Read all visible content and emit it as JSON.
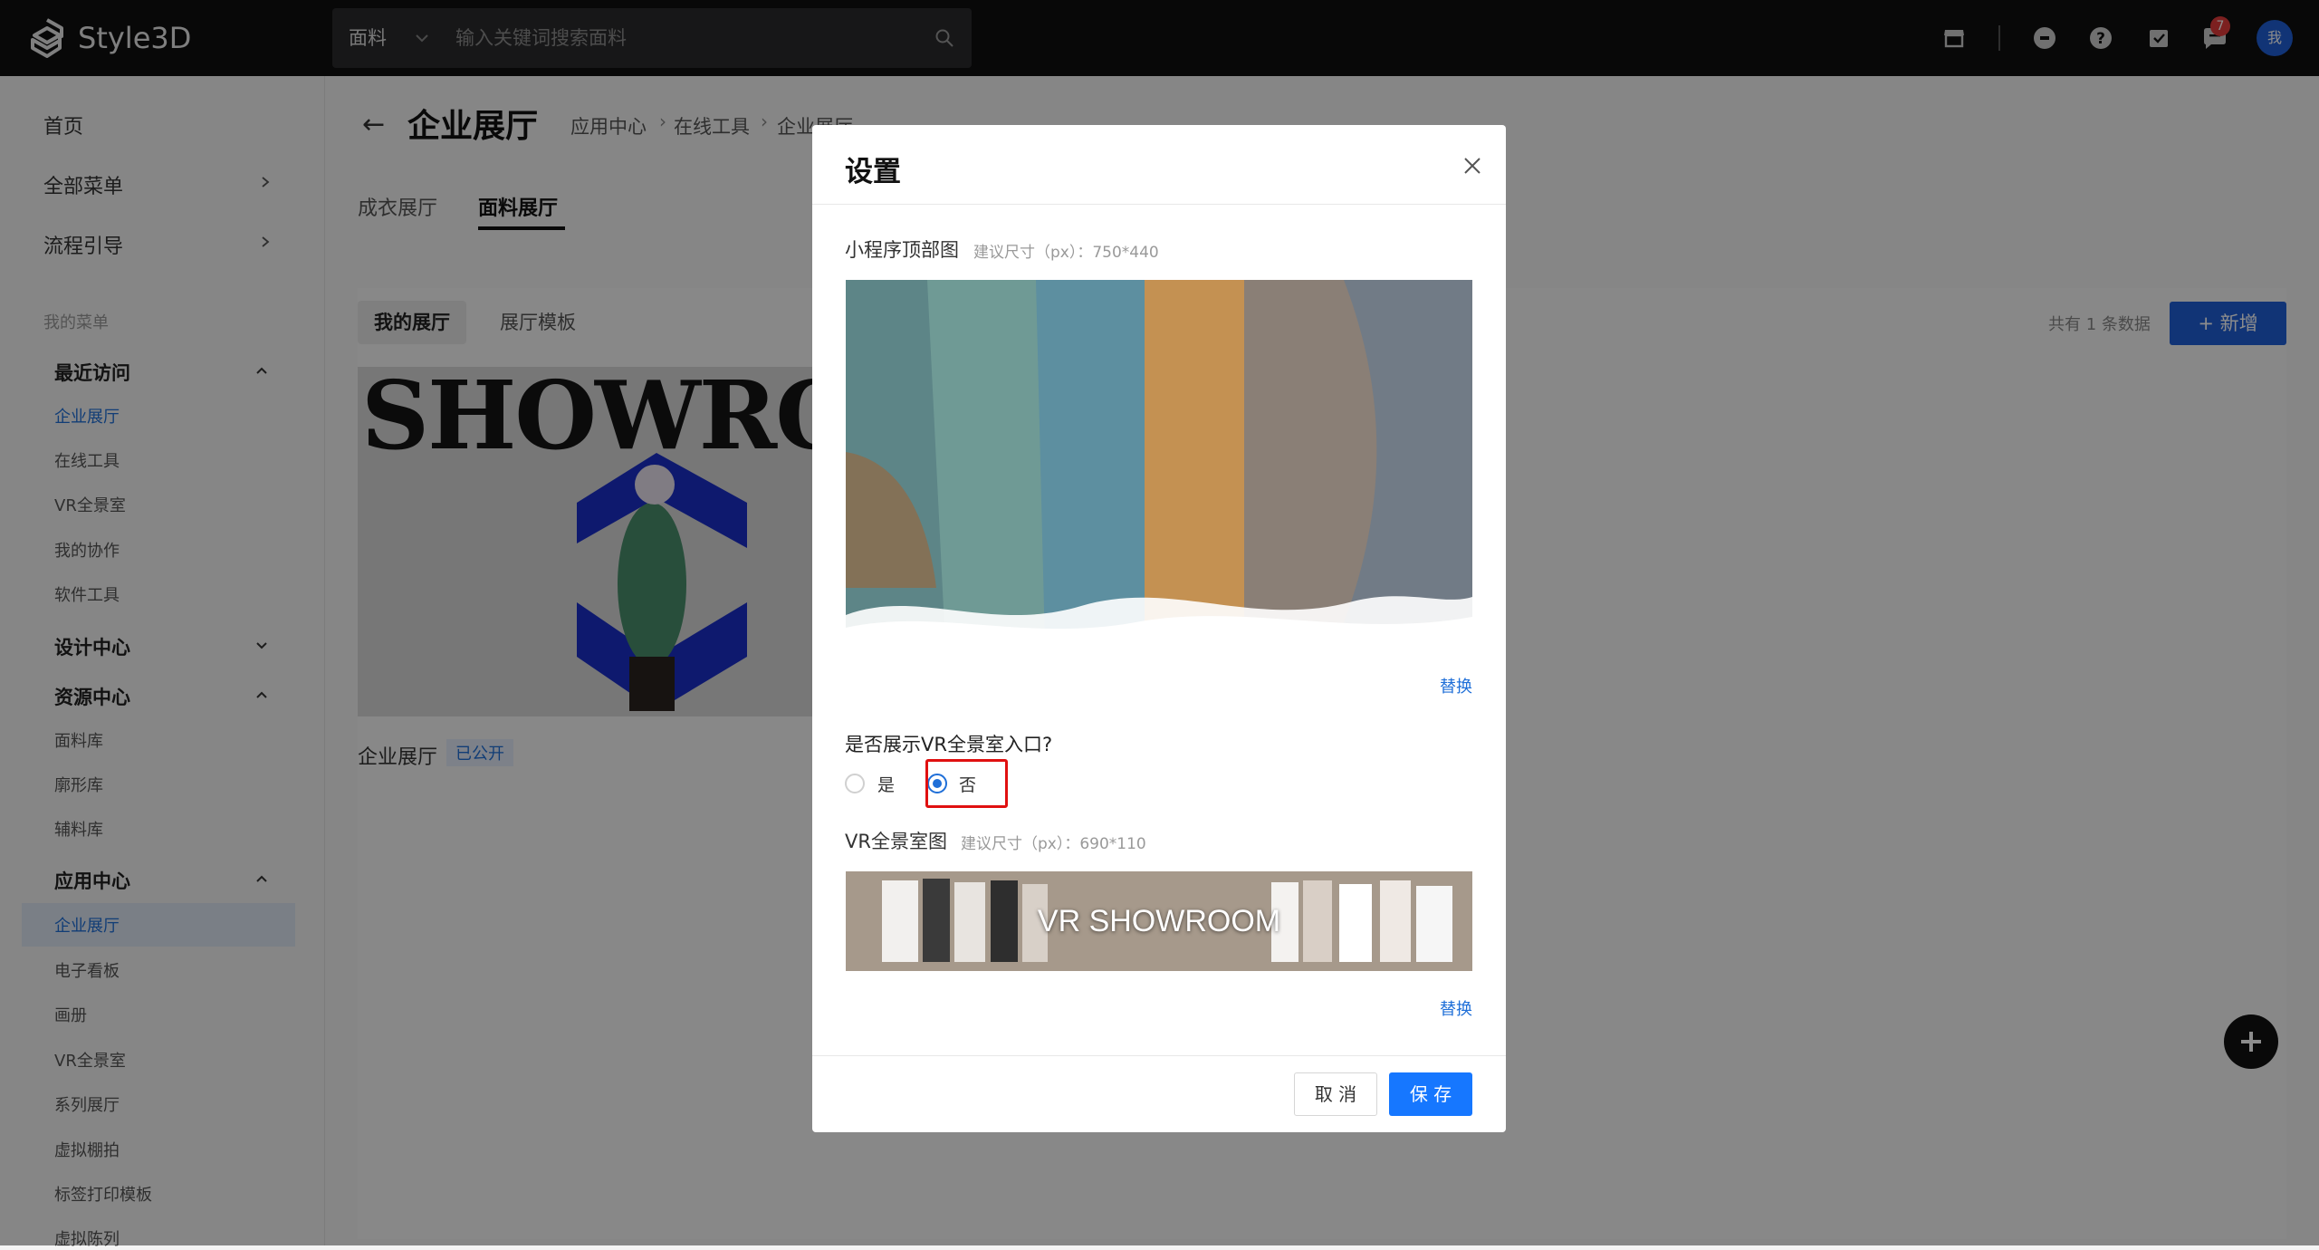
{
  "app": {
    "name": "Style3D"
  },
  "search": {
    "category": "面料",
    "placeholder": "输入关键词搜索面料"
  },
  "topbar": {
    "notification_count": "7",
    "avatar_text": "我"
  },
  "sidebar": {
    "top_items": [
      {
        "label": "首页"
      },
      {
        "label": "全部菜单"
      },
      {
        "label": "流程引导"
      }
    ],
    "my_menu_label": "我的菜单",
    "groups": [
      {
        "title": "最近访问",
        "items": [
          "企业展厅",
          "在线工具",
          "VR全景室",
          "我的协作",
          "软件工具"
        ]
      },
      {
        "title": "设计中心",
        "items": []
      },
      {
        "title": "资源中心",
        "items": [
          "面料库",
          "廓形库",
          "辅料库"
        ]
      },
      {
        "title": "应用中心",
        "items": [
          "企业展厅",
          "电子看板",
          "画册",
          "VR全景室",
          "系列展厅",
          "虚拟棚拍",
          "标签打印模板",
          "虚拟陈列"
        ]
      }
    ]
  },
  "main": {
    "page_title": "企业展厅",
    "breadcrumb": [
      "应用中心",
      "在线工具",
      "企业展厅"
    ],
    "tabs": [
      "成衣展厅",
      "面料展厅"
    ],
    "active_tab": "面料展厅",
    "segments": [
      "我的展厅",
      "展厅模板"
    ],
    "count_text": "共有 1 条数据",
    "new_button": "+ 新增",
    "card": {
      "image_text": "SHOWROOM",
      "label": "企业展厅",
      "badge": "已公开"
    }
  },
  "modal": {
    "title": "设置",
    "top_image": {
      "label": "小程序顶部图",
      "hint": "建议尺寸（px）：750*440",
      "replace": "替换"
    },
    "question": "是否展示VR全景室入口?",
    "options": [
      {
        "label": "是",
        "selected": false
      },
      {
        "label": "否",
        "selected": true
      }
    ],
    "vr_image": {
      "label": "VR全景室图",
      "hint": "建议尺寸（px）：690*110",
      "overlay_text": "VR SHOWROOM",
      "replace": "替换"
    },
    "cancel": "取 消",
    "save": "保 存"
  },
  "colors": {
    "accent": "#1677ff",
    "highlight": "#e01010",
    "topbar": "#0f0f10"
  }
}
